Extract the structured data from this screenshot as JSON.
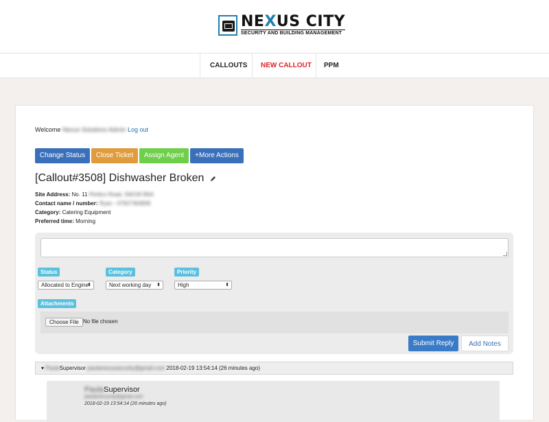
{
  "brand": {
    "name_prefix": "NE",
    "name_x": "X",
    "name_suffix": "US CITY",
    "tagline": "SECURITY AND BUILDING MANAGEMENT",
    "accent_color": "#1e7fb0"
  },
  "nav": {
    "items": [
      {
        "label": "CALLOUTS",
        "active": false
      },
      {
        "label": "NEW CALLOUT",
        "active": true
      },
      {
        "label": "PPM",
        "active": false
      }
    ],
    "active_color": "#e0212a"
  },
  "welcome": {
    "prefix": "Welcome",
    "user": "Nexus Solutions Admin",
    "logout": "Log out"
  },
  "actions": {
    "change_status": "Change Status",
    "close_ticket": "Close Ticket",
    "assign_agent": "Assign Agent",
    "more_actions": "+More Actions",
    "colors": {
      "blue": "#3a6fba",
      "orange": "#e09b3c",
      "green": "#6fce4a"
    }
  },
  "callout": {
    "title": "[Callout#3508] Dishwasher Broken",
    "site_address_label": "Site Address:",
    "site_address_visible": "No. 11",
    "site_address_blurred": "Pimlico Road, SW1W 8NA",
    "contact_label": "Contact name / number:",
    "contact_blurred": "Ryan - 07927363836",
    "category_label": "Category:",
    "category_value": "Catering Equipment",
    "preferred_time_label": "Preferred time:",
    "preferred_time_value": "Morning"
  },
  "reply_form": {
    "message_value": "",
    "status_label": "Status",
    "status_value": "Allocated to Engine",
    "category_label": "Category",
    "category_value": "Next working day",
    "priority_label": "Priority",
    "priority_value": "High",
    "attachments_label": "Attachments",
    "choose_file": "Choose File",
    "no_file": "No file chosen",
    "submit": "Submit Reply",
    "add_notes": "Add Notes"
  },
  "thread": {
    "header_name_blurred": "Paula",
    "header_role": "Supervisor",
    "header_email_blurred": "paulanexussecurity@gmail.com",
    "header_timestamp": "2018-02-19 13:54:14 (26 minutes ago)",
    "entry_name_blurred": "Paula",
    "entry_role": "Supervisor",
    "entry_email_blurred": "paulanexuscity@gmail.com",
    "entry_timestamp": "2018-02-19 13:54:14 (26 minutes ago)"
  }
}
